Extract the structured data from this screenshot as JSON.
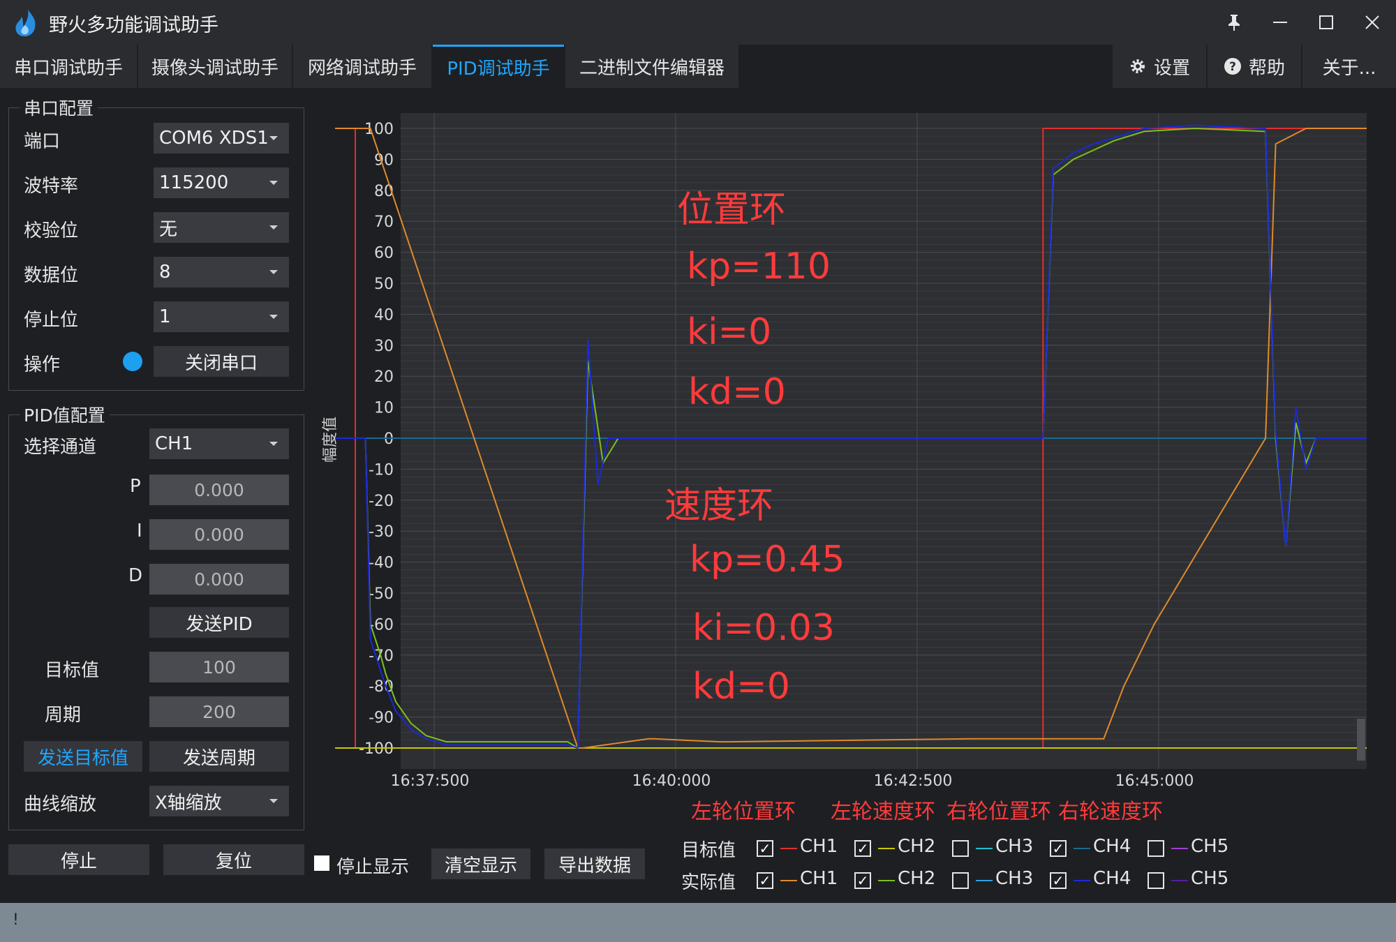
{
  "app": {
    "title": "野火多功能调试助手",
    "window_controls": [
      "pin-icon",
      "minimize-icon",
      "maximize-icon",
      "close-icon"
    ]
  },
  "tabs": [
    {
      "label": "串口调试助手",
      "active": false
    },
    {
      "label": "摄像头调试助手",
      "active": false
    },
    {
      "label": "网络调试助手",
      "active": false
    },
    {
      "label": "PID调试助手",
      "active": true
    },
    {
      "label": "二进制文件编辑器",
      "active": false
    }
  ],
  "toolbar": {
    "settings_label": "设置",
    "help_label": "帮助",
    "about_label": "关于..."
  },
  "serial_config": {
    "title": "串口配置",
    "port_label": "端口",
    "port_value": "COM6 XDS1",
    "baud_label": "波特率",
    "baud_value": "115200",
    "parity_label": "校验位",
    "parity_value": "无",
    "databits_label": "数据位",
    "databits_value": "8",
    "stopbits_label": "停止位",
    "stopbits_value": "1",
    "operation_label": "操作",
    "status_color": "#1ea0f0",
    "close_port_label": "关闭串口"
  },
  "pid_config": {
    "title": "PID值配置",
    "channel_label": "选择通道",
    "channel_value": "CH1",
    "p_label": "P",
    "p_value": "0.000",
    "i_label": "I",
    "i_value": "0.000",
    "d_label": "D",
    "d_value": "0.000",
    "send_pid_label": "发送PID",
    "target_label": "目标值",
    "target_value": "100",
    "period_label": "周期",
    "period_value": "200",
    "send_target_label": "发送目标值",
    "send_period_label": "发送周期",
    "zoom_label": "曲线缩放",
    "zoom_value": "X轴缩放"
  },
  "bottom_controls": {
    "stop_label": "停止",
    "reset_label": "复位",
    "stop_display_label": "停止显示",
    "stop_display_checked": false,
    "clear_label": "清空显示",
    "export_label": "导出数据"
  },
  "annotations": {
    "position_loop": "位置环",
    "pos_kp": "kp=110",
    "pos_ki": "ki=0",
    "pos_kd": "kd=0",
    "speed_loop": "速度环",
    "spd_kp": "kp=0.45",
    "spd_ki": "ki=0.03",
    "spd_kd": "kd=0",
    "annotation_color": "#ff3b3b"
  },
  "chart_data": {
    "type": "line",
    "ylabel": "幅度值",
    "ylim": [
      -100,
      100
    ],
    "yticks": [
      100,
      90,
      80,
      70,
      60,
      50,
      40,
      30,
      20,
      10,
      0,
      -10,
      -20,
      -30,
      -40,
      -50,
      -60,
      -70,
      -80,
      -90,
      -100
    ],
    "xtick_labels": [
      "16:37:500",
      "16:40:000",
      "16:42:500",
      "16:45:000"
    ],
    "grid": true,
    "series": [
      {
        "name": "目标值 CH1",
        "color": "#e03030",
        "x": [
          0,
          0.2,
          0.2,
          7.0,
          7.0,
          10.2
        ],
        "y": [
          100,
          100,
          -100,
          -100,
          100,
          100
        ]
      },
      {
        "name": "目标值 CH2",
        "color": "#c8c800",
        "x": [
          0,
          10.2
        ],
        "y": [
          -100,
          -100
        ]
      },
      {
        "name": "目标值 CH4",
        "color": "#1b6a8a",
        "x": [
          0,
          10.2
        ],
        "y": [
          0,
          0
        ]
      },
      {
        "name": "实际值 CH1",
        "color": "#e08a2a",
        "x": [
          0,
          0.35,
          2.4,
          2.45,
          3.1,
          3.15,
          3.8,
          3.9,
          6.3,
          7.6,
          7.8,
          8.1,
          9.2,
          9.3,
          9.6,
          10.2
        ],
        "y": [
          100,
          100,
          -100,
          -100,
          -97,
          -97,
          -98,
          -98,
          -97,
          -97,
          -80,
          -60,
          0,
          95,
          100,
          100
        ]
      },
      {
        "name": "实际值 CH2",
        "color": "#7ac020",
        "x": [
          0,
          0.3,
          0.35,
          0.45,
          0.5,
          0.6,
          0.75,
          0.9,
          1.1,
          1.6,
          2.3,
          2.4,
          2.5,
          2.65,
          2.8,
          2.95,
          3.1,
          7.0,
          7.1,
          7.3,
          7.5,
          7.7,
          8.0,
          8.5,
          9.2,
          9.3,
          9.4,
          9.5,
          9.6,
          9.7,
          9.8,
          10.2
        ],
        "y": [
          0,
          0,
          -60,
          -70,
          -76,
          -85,
          -92,
          -96,
          -98,
          -98,
          -98,
          -100,
          25,
          -8,
          0,
          0,
          0,
          0,
          85,
          90,
          93,
          96,
          99,
          100,
          99,
          0,
          -35,
          5,
          -8,
          0,
          0,
          0
        ]
      },
      {
        "name": "实际值 CH4",
        "color": "#1a2ad8",
        "x": [
          0,
          0.3,
          0.35,
          0.45,
          0.5,
          0.6,
          0.75,
          0.9,
          1.1,
          1.6,
          2.3,
          2.4,
          2.5,
          2.6,
          2.7,
          2.9,
          3.1,
          7.0,
          7.1,
          7.3,
          7.5,
          7.7,
          8.0,
          8.5,
          9.2,
          9.3,
          9.4,
          9.5,
          9.6,
          9.7,
          10.2
        ],
        "y": [
          0,
          0,
          -65,
          -75,
          -80,
          -88,
          -94,
          -97,
          -99,
          -99,
          -99,
          -100,
          32,
          -15,
          0,
          0,
          0,
          0,
          87,
          92,
          95,
          97,
          100,
          101,
          100,
          2,
          -35,
          10,
          -10,
          0,
          0
        ]
      }
    ]
  },
  "legend": {
    "headers": [
      "左轮位置环",
      "左轮速度环",
      "右轮位置环",
      "右轮速度环"
    ],
    "header_color": "#ff3b3b",
    "target_row_label": "目标值",
    "actual_row_label": "实际值",
    "target_channels": [
      {
        "label": "CH1",
        "checked": true,
        "color": "#e03030"
      },
      {
        "label": "CH2",
        "checked": true,
        "color": "#c8c800"
      },
      {
        "label": "CH3",
        "checked": false,
        "color": "#20c0d0"
      },
      {
        "label": "CH4",
        "checked": true,
        "color": "#1b6a8a"
      },
      {
        "label": "CH5",
        "checked": false,
        "color": "#a040d0"
      }
    ],
    "actual_channels": [
      {
        "label": "CH1",
        "checked": true,
        "color": "#e08a2a"
      },
      {
        "label": "CH2",
        "checked": true,
        "color": "#7ac020"
      },
      {
        "label": "CH3",
        "checked": false,
        "color": "#2aa0e0"
      },
      {
        "label": "CH4",
        "checked": true,
        "color": "#1a2ad8"
      },
      {
        "label": "CH5",
        "checked": false,
        "color": "#5020a0"
      }
    ]
  },
  "statusbar": {
    "text": "!"
  }
}
